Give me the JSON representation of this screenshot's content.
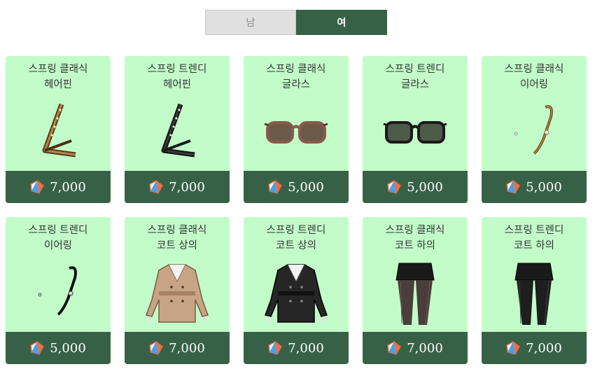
{
  "tabs": {
    "male": "남",
    "female": "여",
    "active": "female"
  },
  "items": [
    {
      "line1": "스프링 클래식",
      "line2": "헤어핀",
      "price": "7,000",
      "icon": "hairpin-icon"
    },
    {
      "line1": "스프링 트렌디",
      "line2": "헤어핀",
      "price": "7,000",
      "icon": "hairpin-icon"
    },
    {
      "line1": "스프링 클래식",
      "line2": "글라스",
      "price": "5,000",
      "icon": "glasses-icon"
    },
    {
      "line1": "스프링 트렌디",
      "line2": "글라스",
      "price": "5,000",
      "icon": "glasses-icon"
    },
    {
      "line1": "스프링 클래식",
      "line2": "이어링",
      "price": "5,000",
      "icon": "earring-icon"
    },
    {
      "line1": "스프링 트렌디",
      "line2": "이어링",
      "price": "5,000",
      "icon": "earring-icon"
    },
    {
      "line1": "스프링 클래식",
      "line2": "코트 상의",
      "price": "7,000",
      "icon": "coat-icon"
    },
    {
      "line1": "스프링 트렌디",
      "line2": "코트 상의",
      "price": "7,000",
      "icon": "coat-icon"
    },
    {
      "line1": "스프링 클래식",
      "line2": "코트 하의",
      "price": "7,000",
      "icon": "leggings-icon"
    },
    {
      "line1": "스프링 트렌디",
      "line2": "코트 하의",
      "price": "7,000",
      "icon": "leggings-icon"
    }
  ],
  "colors": {
    "card_bg": "#c2fdc9",
    "accent": "#376146",
    "tab_off": "#e0e0e0"
  }
}
